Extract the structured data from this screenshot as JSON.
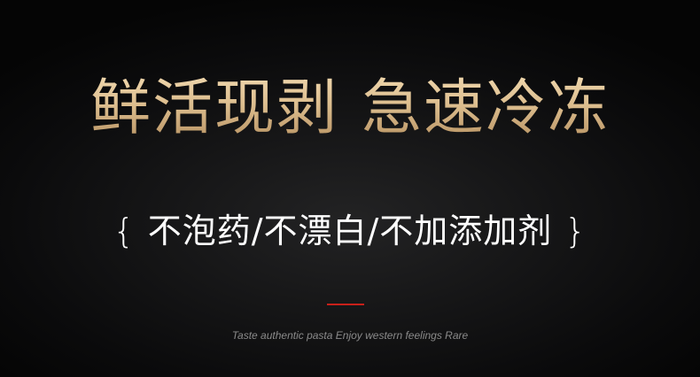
{
  "banner": {
    "headline_left": "鲜活现剥",
    "headline_right": "急速冷冻",
    "subtitle_open": "{",
    "subtitle_text": "不泡药/不漂白/不加添加剂",
    "subtitle_close": "}",
    "tagline": "Taste authentic pasta Enjoy western feelings Rare",
    "colors": {
      "headline_gold": "#d9b98a",
      "divider_red": "#c8201a",
      "subtitle_white": "#ffffff",
      "tagline_gray": "#8a8a8a",
      "background": "#0b0b0c"
    }
  }
}
